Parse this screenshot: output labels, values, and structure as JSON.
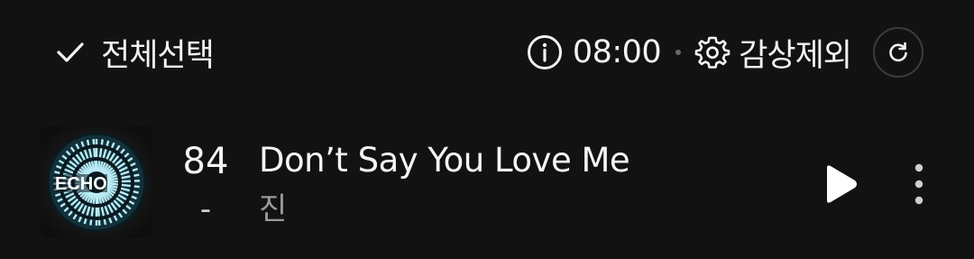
{
  "header": {
    "select_all_label": "전체선택",
    "timer_text": "08:00",
    "exclude_label": "감상제외"
  },
  "icons": {
    "select_all": "check-icon",
    "info": "info-circle-icon",
    "exclude": "gear-icon",
    "refresh": "refresh-icon",
    "play": "play-icon",
    "more": "more-vertical-icon"
  },
  "track": {
    "rank": "84",
    "rank_change": "-",
    "title": "Don’t Say You Love Me",
    "artist": "진",
    "cover_text": "ECHO"
  },
  "colors": {
    "background": "#121212",
    "text_primary": "#f2f2f2",
    "text_secondary": "#9a9a9a"
  }
}
